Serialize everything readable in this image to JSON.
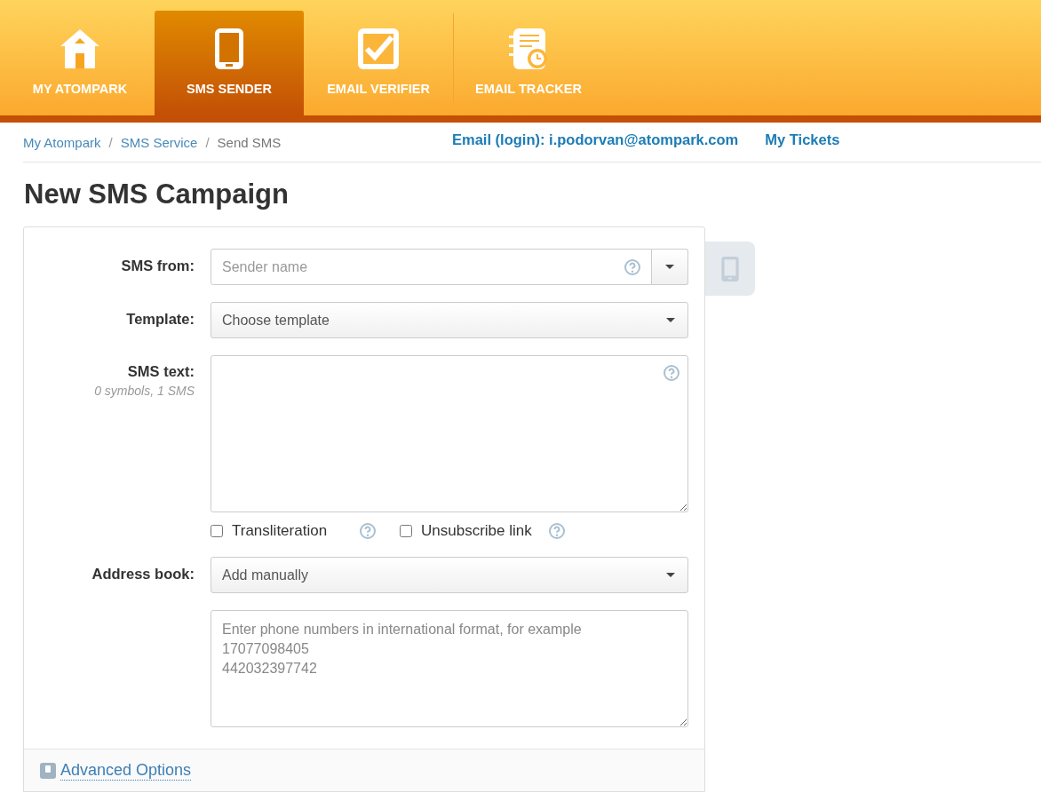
{
  "nav": {
    "tabs": [
      {
        "label": "MY ATOMPARK",
        "kind": "home",
        "selected": false
      },
      {
        "label": "SMS SENDER",
        "kind": "phone",
        "selected": true
      },
      {
        "label": "EMAIL VERIFIER",
        "kind": "check",
        "selected": false
      },
      {
        "label": "EMAIL TRACKER",
        "kind": "tracker",
        "selected": false
      }
    ]
  },
  "breadcrumb": [
    {
      "label": "My Atompark",
      "kind": "link"
    },
    {
      "label": "SMS Service",
      "kind": "link"
    },
    {
      "label": "Send SMS",
      "kind": "current"
    }
  ],
  "breadcrumb_separator": "/",
  "account": {
    "email": "Email (login): i.podorvan@atompark.com",
    "tickets": "My Tickets"
  },
  "title": "New SMS Campaign",
  "form": {
    "sms_from": {
      "label": "SMS from:",
      "placeholder": "Sender name"
    },
    "template": {
      "label": "Template:",
      "value": "Choose template"
    },
    "sms_text": {
      "label": "SMS text:",
      "hint": "0 symbols, 1 SMS"
    },
    "options": [
      {
        "label": "Transliteration",
        "checked": false
      },
      {
        "label": "Unsubscribe link",
        "checked": false
      }
    ],
    "address_book": {
      "label": "Address book:",
      "value": "Add manually"
    },
    "phones": {
      "placeholder": "Enter phone numbers in international format, for example\n17077098405\n442032397742"
    },
    "advanced": "Advanced Options"
  }
}
